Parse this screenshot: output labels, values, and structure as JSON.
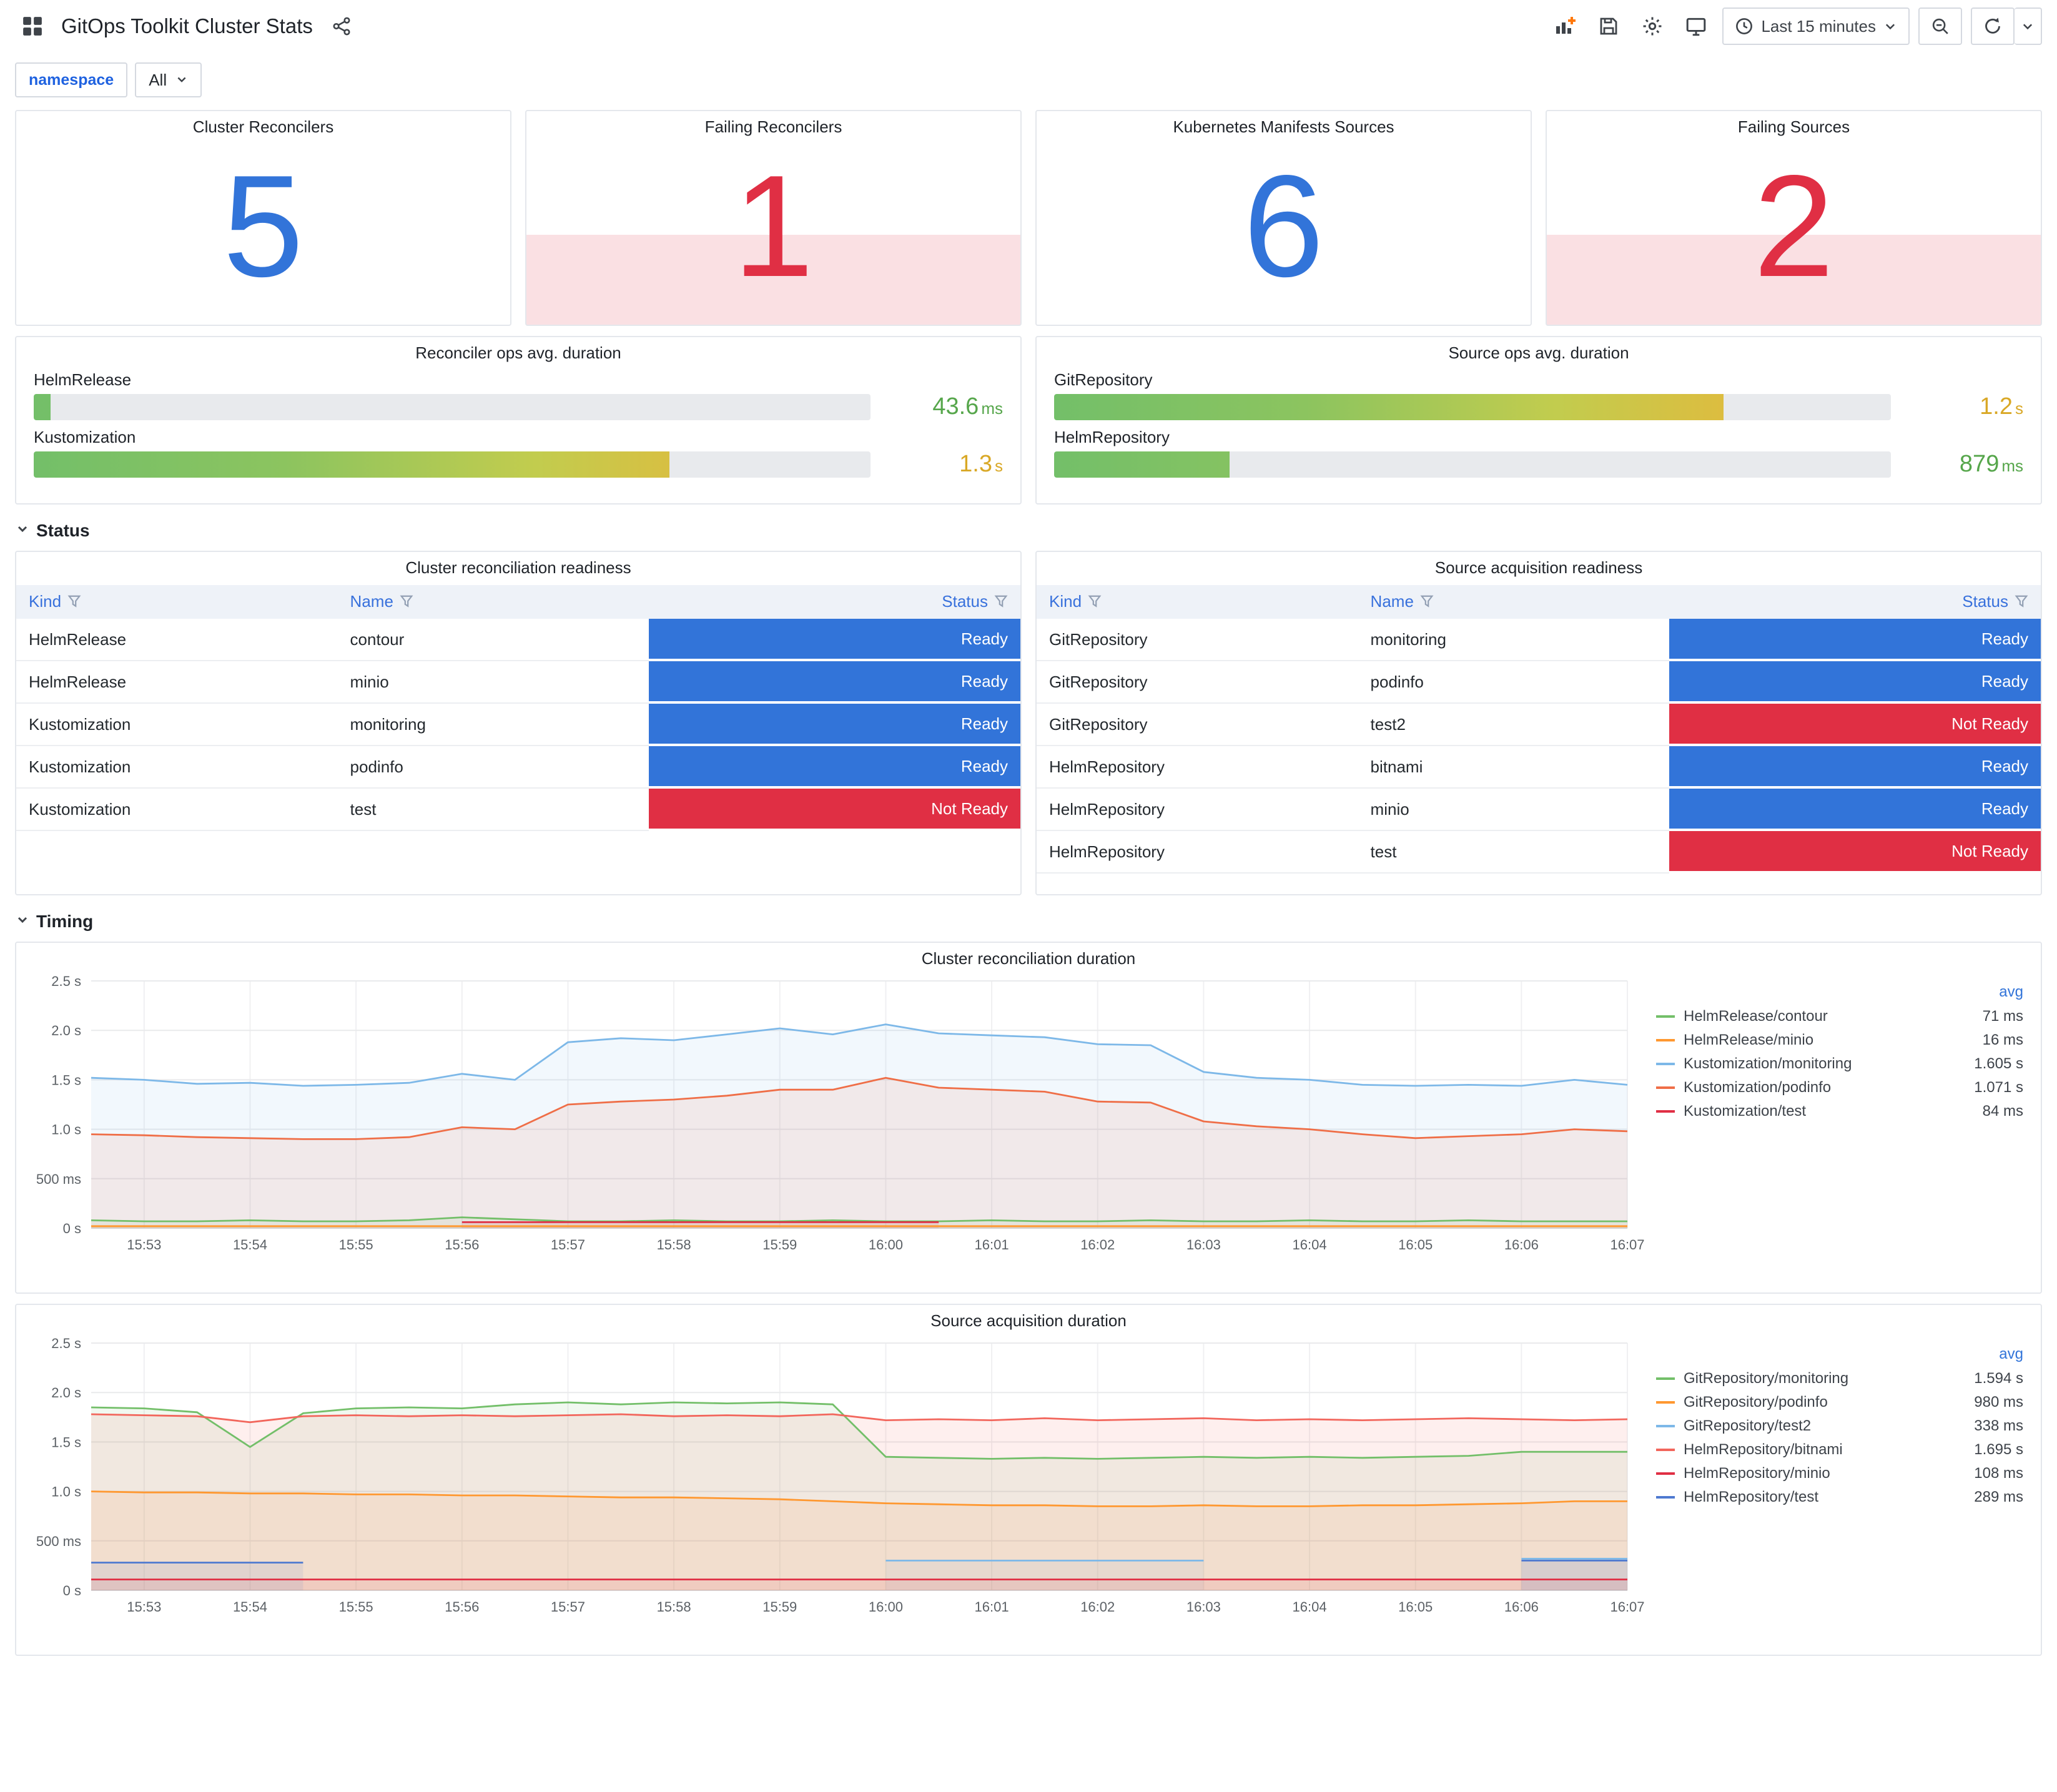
{
  "header": {
    "title": "GitOps Toolkit Cluster Stats",
    "time_picker": "Last 15 minutes"
  },
  "variables": {
    "label": "namespace",
    "value": "All"
  },
  "icons": {
    "dashboards-grid": "grid-squares",
    "share": "share-nodes",
    "add-panel": "bar-chart-plus",
    "save-dashboard": "floppy-disk",
    "dashboard-settings": "gear",
    "cycle-view": "monitor",
    "clock": "clock-face",
    "chevron-down": "chevron",
    "zoom-out": "magnifier-minus",
    "refresh": "circular-arrow",
    "filter": "funnel"
  },
  "colors": {
    "ok": "#3274D9",
    "alert": "#E02F44",
    "ready": "#3274D9",
    "not_ready": "#E02F44"
  },
  "stat_panels": [
    {
      "title": "Cluster Reconcilers",
      "value": "5",
      "state": "ok"
    },
    {
      "title": "Failing Reconcilers",
      "value": "1",
      "state": "alert"
    },
    {
      "title": "Kubernetes Manifests Sources",
      "value": "6",
      "state": "ok"
    },
    {
      "title": "Failing Sources",
      "value": "2",
      "state": "alert"
    }
  ],
  "gauge_panels": [
    {
      "title": "Reconciler ops avg. duration",
      "rows": [
        {
          "label": "HelmRelease",
          "value": "43.6",
          "unit": "ms",
          "pct": 2,
          "value_color": "#56A64B"
        },
        {
          "label": "Kustomization",
          "value": "1.3",
          "unit": "s",
          "pct": 76,
          "value_color": "#D9A826"
        }
      ]
    },
    {
      "title": "Source ops avg. duration",
      "rows": [
        {
          "label": "GitRepository",
          "value": "1.2",
          "unit": "s",
          "pct": 80,
          "value_color": "#D9A826"
        },
        {
          "label": "HelmRepository",
          "value": "879",
          "unit": "ms",
          "pct": 21,
          "value_color": "#56A64B"
        }
      ]
    }
  ],
  "sections": {
    "status": "Status",
    "timing": "Timing"
  },
  "status_colors": {
    "Ready": "#3274D9",
    "Not Ready": "#E02F44"
  },
  "table_panels": [
    {
      "title": "Cluster reconciliation readiness",
      "columns": [
        "Kind",
        "Name",
        "Status"
      ],
      "rows": [
        {
          "kind": "HelmRelease",
          "name": "contour",
          "status": "Ready"
        },
        {
          "kind": "HelmRelease",
          "name": "minio",
          "status": "Ready"
        },
        {
          "kind": "Kustomization",
          "name": "monitoring",
          "status": "Ready"
        },
        {
          "kind": "Kustomization",
          "name": "podinfo",
          "status": "Ready"
        },
        {
          "kind": "Kustomization",
          "name": "test",
          "status": "Not Ready"
        }
      ]
    },
    {
      "title": "Source acquisition readiness",
      "columns": [
        "Kind",
        "Name",
        "Status"
      ],
      "rows": [
        {
          "kind": "GitRepository",
          "name": "monitoring",
          "status": "Ready"
        },
        {
          "kind": "GitRepository",
          "name": "podinfo",
          "status": "Ready"
        },
        {
          "kind": "GitRepository",
          "name": "test2",
          "status": "Not Ready"
        },
        {
          "kind": "HelmRepository",
          "name": "bitnami",
          "status": "Ready"
        },
        {
          "kind": "HelmRepository",
          "name": "minio",
          "status": "Ready"
        },
        {
          "kind": "HelmRepository",
          "name": "test",
          "status": "Not Ready"
        }
      ]
    }
  ],
  "chart_data": [
    {
      "type": "line",
      "title": "Cluster reconciliation duration",
      "legend_header": "avg",
      "y_max": 2.5,
      "y_tick_values": [
        0,
        0.5,
        1,
        1.5,
        2,
        2.5
      ],
      "y_tick_labels": [
        "0 s",
        "500 ms",
        "1.0 s",
        "1.5 s",
        "2.0 s",
        "2.5 s"
      ],
      "x_span": 14.5,
      "sample_step_min": 0.5,
      "x_start_time": "15:52:30",
      "x_tick_minutes": [
        0.5,
        1.5,
        2.5,
        3.5,
        4.5,
        5.5,
        6.5,
        7.5,
        8.5,
        9.5,
        10.5,
        11.5,
        12.5,
        13.5,
        14.5
      ],
      "x_tick_labels": [
        "15:53",
        "15:54",
        "15:55",
        "15:56",
        "15:57",
        "15:58",
        "15:59",
        "16:00",
        "16:01",
        "16:02",
        "16:03",
        "16:04",
        "16:05",
        "16:06",
        "16:07"
      ],
      "series": [
        {
          "name": "HelmRelease/contour",
          "avg": "71 ms",
          "color": "#73BF69",
          "values": [
            0.08,
            0.07,
            0.07,
            0.08,
            0.07,
            0.07,
            0.08,
            0.11,
            0.09,
            0.07,
            0.07,
            0.08,
            0.07,
            0.07,
            0.08,
            0.07,
            0.07,
            0.08,
            0.07,
            0.07,
            0.08,
            0.07,
            0.07,
            0.08,
            0.07,
            0.07,
            0.08,
            0.07,
            0.07,
            0.07
          ]
        },
        {
          "name": "HelmRelease/minio",
          "avg": "16 ms",
          "color": "#FF9830",
          "values": [
            0.02,
            0.02,
            0.02,
            0.02,
            0.02,
            0.02,
            0.02,
            0.02,
            0.02,
            0.02,
            0.02,
            0.02,
            0.02,
            0.02,
            0.02,
            0.02,
            0.02,
            0.02,
            0.02,
            0.02,
            0.02,
            0.02,
            0.02,
            0.02,
            0.02,
            0.02,
            0.02,
            0.02,
            0.02,
            0.02
          ]
        },
        {
          "name": "Kustomization/monitoring",
          "avg": "1.605 s",
          "color": "#7DB8E8",
          "values": [
            1.52,
            1.5,
            1.46,
            1.47,
            1.44,
            1.45,
            1.47,
            1.56,
            1.5,
            1.88,
            1.92,
            1.9,
            1.96,
            2.02,
            1.96,
            2.06,
            1.97,
            1.95,
            1.93,
            1.86,
            1.85,
            1.58,
            1.52,
            1.5,
            1.45,
            1.44,
            1.45,
            1.44,
            1.5,
            1.45
          ]
        },
        {
          "name": "Kustomization/podinfo",
          "avg": "1.071 s",
          "color": "#EF6E47",
          "values": [
            0.95,
            0.94,
            0.92,
            0.91,
            0.9,
            0.9,
            0.92,
            1.02,
            1.0,
            1.25,
            1.28,
            1.3,
            1.34,
            1.4,
            1.4,
            1.52,
            1.42,
            1.4,
            1.38,
            1.28,
            1.27,
            1.08,
            1.03,
            1.0,
            0.95,
            0.91,
            0.93,
            0.95,
            1.0,
            0.98
          ]
        },
        {
          "name": "Kustomization/test",
          "avg": "84 ms",
          "color": "#E02F44",
          "values": [
            null,
            null,
            null,
            null,
            null,
            null,
            null,
            0.06,
            0.06,
            0.06,
            0.06,
            0.06,
            0.06,
            0.06,
            0.06,
            0.06,
            0.06,
            null,
            null,
            null,
            null,
            null,
            null,
            null,
            null,
            null,
            null,
            null,
            null,
            null
          ]
        }
      ]
    },
    {
      "type": "line",
      "title": "Source acquisition duration",
      "legend_header": "avg",
      "y_max": 2.5,
      "y_tick_values": [
        0,
        0.5,
        1,
        1.5,
        2,
        2.5
      ],
      "y_tick_labels": [
        "0 s",
        "500 ms",
        "1.0 s",
        "1.5 s",
        "2.0 s",
        "2.5 s"
      ],
      "x_span": 14.5,
      "sample_step_min": 0.5,
      "x_start_time": "15:52:30",
      "x_tick_minutes": [
        0.5,
        1.5,
        2.5,
        3.5,
        4.5,
        5.5,
        6.5,
        7.5,
        8.5,
        9.5,
        10.5,
        11.5,
        12.5,
        13.5,
        14.5
      ],
      "x_tick_labels": [
        "15:53",
        "15:54",
        "15:55",
        "15:56",
        "15:57",
        "15:58",
        "15:59",
        "16:00",
        "16:01",
        "16:02",
        "16:03",
        "16:04",
        "16:05",
        "16:06",
        "16:07"
      ],
      "series": [
        {
          "name": "GitRepository/monitoring",
          "avg": "1.594 s",
          "color": "#73BF69",
          "values": [
            1.85,
            1.84,
            1.8,
            1.45,
            1.79,
            1.84,
            1.85,
            1.84,
            1.88,
            1.9,
            1.88,
            1.9,
            1.89,
            1.9,
            1.88,
            1.35,
            1.34,
            1.33,
            1.34,
            1.33,
            1.34,
            1.35,
            1.34,
            1.35,
            1.34,
            1.35,
            1.36,
            1.4,
            1.4,
            1.4
          ]
        },
        {
          "name": "GitRepository/podinfo",
          "avg": "980 ms",
          "color": "#FF9830",
          "values": [
            1.0,
            0.99,
            0.99,
            0.98,
            0.98,
            0.97,
            0.97,
            0.96,
            0.96,
            0.95,
            0.94,
            0.94,
            0.93,
            0.92,
            0.9,
            0.88,
            0.87,
            0.86,
            0.86,
            0.85,
            0.85,
            0.86,
            0.85,
            0.85,
            0.86,
            0.86,
            0.87,
            0.88,
            0.9,
            0.9
          ]
        },
        {
          "name": "GitRepository/test2",
          "avg": "338 ms",
          "color": "#7DB8E8",
          "values": [
            null,
            null,
            null,
            null,
            null,
            null,
            null,
            null,
            null,
            null,
            null,
            null,
            null,
            null,
            null,
            0.3,
            0.3,
            0.3,
            0.3,
            0.3,
            0.3,
            0.3,
            null,
            null,
            null,
            null,
            null,
            0.32,
            0.32,
            0.32
          ]
        },
        {
          "name": "HelmRepository/bitnami",
          "avg": "1.695 s",
          "color": "#F2665C",
          "values": [
            1.78,
            1.77,
            1.76,
            1.7,
            1.76,
            1.77,
            1.76,
            1.77,
            1.76,
            1.77,
            1.78,
            1.76,
            1.77,
            1.76,
            1.78,
            1.72,
            1.73,
            1.72,
            1.74,
            1.72,
            1.73,
            1.74,
            1.72,
            1.73,
            1.72,
            1.73,
            1.74,
            1.73,
            1.72,
            1.73
          ]
        },
        {
          "name": "HelmRepository/minio",
          "avg": "108 ms",
          "color": "#E02F44",
          "values": [
            0.11,
            0.11,
            0.11,
            0.11,
            0.11,
            0.11,
            0.11,
            0.11,
            0.11,
            0.11,
            0.11,
            0.11,
            0.11,
            0.11,
            0.11,
            0.11,
            0.11,
            0.11,
            0.11,
            0.11,
            0.11,
            0.11,
            0.11,
            0.11,
            0.11,
            0.11,
            0.11,
            0.11,
            0.11,
            0.11
          ]
        },
        {
          "name": "HelmRepository/test",
          "avg": "289 ms",
          "color": "#4E79D0",
          "values": [
            0.28,
            0.28,
            0.28,
            0.28,
            0.28,
            null,
            null,
            null,
            null,
            null,
            null,
            null,
            null,
            null,
            null,
            null,
            null,
            null,
            null,
            null,
            null,
            null,
            null,
            null,
            null,
            null,
            null,
            0.3,
            0.3,
            0.3
          ]
        }
      ]
    }
  ]
}
